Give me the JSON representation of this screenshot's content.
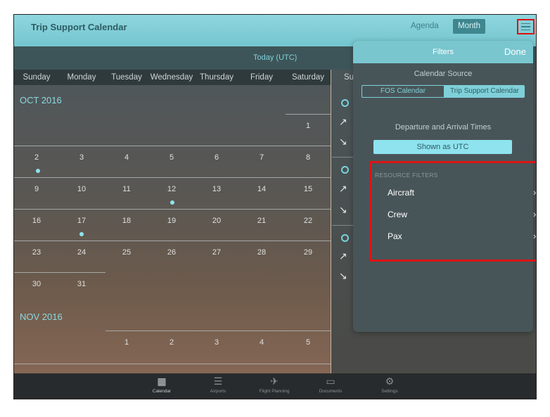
{
  "header": {
    "title": "Trip Support Calendar",
    "agenda_label": "Agenda",
    "month_label": "Month",
    "menu_icon": "hamburger-menu-icon"
  },
  "today_label": "Today (UTC)",
  "weekdays": [
    "Sunday",
    "Monday",
    "Tuesday",
    "Wednesday",
    "Thursday",
    "Friday",
    "Saturday"
  ],
  "right_pane": {
    "day_label": "Su"
  },
  "calendar": {
    "oct_label": "OCT 2016",
    "oct_days": [
      "1",
      "2",
      "3",
      "4",
      "5",
      "6",
      "7",
      "8",
      "9",
      "10",
      "11",
      "12",
      "13",
      "14",
      "15",
      "16",
      "17",
      "18",
      "19",
      "20",
      "21",
      "22",
      "23",
      "24",
      "25",
      "26",
      "27",
      "28",
      "29",
      "30",
      "31"
    ],
    "nov_label": "NOV 2016",
    "nov_days": [
      "1",
      "2",
      "3",
      "4",
      "5"
    ]
  },
  "filters": {
    "title": "Filters",
    "done_label": "Done",
    "calendar_source_label": "Calendar Source",
    "fos_option": "FOS Calendar",
    "trip_option": "Trip Support Calendar",
    "times_label": "Departure and Arrival Times",
    "utc_button": "Shown as UTC",
    "resource_title": "RESOURCE FILTERS",
    "resource_items": [
      "Aircraft",
      "Crew",
      "Pax"
    ]
  },
  "tabbar": {
    "items": [
      {
        "label": "Calendar",
        "icon": "calendar-icon"
      },
      {
        "label": "Airports",
        "icon": "list-icon"
      },
      {
        "label": "Flight Planning",
        "icon": "airplane-icon"
      },
      {
        "label": "Documents",
        "icon": "folder-icon"
      },
      {
        "label": "Settings",
        "icon": "gear-icon"
      }
    ]
  },
  "colors": {
    "accent": "#79c6cf",
    "highlight_box": "#dd1414"
  }
}
